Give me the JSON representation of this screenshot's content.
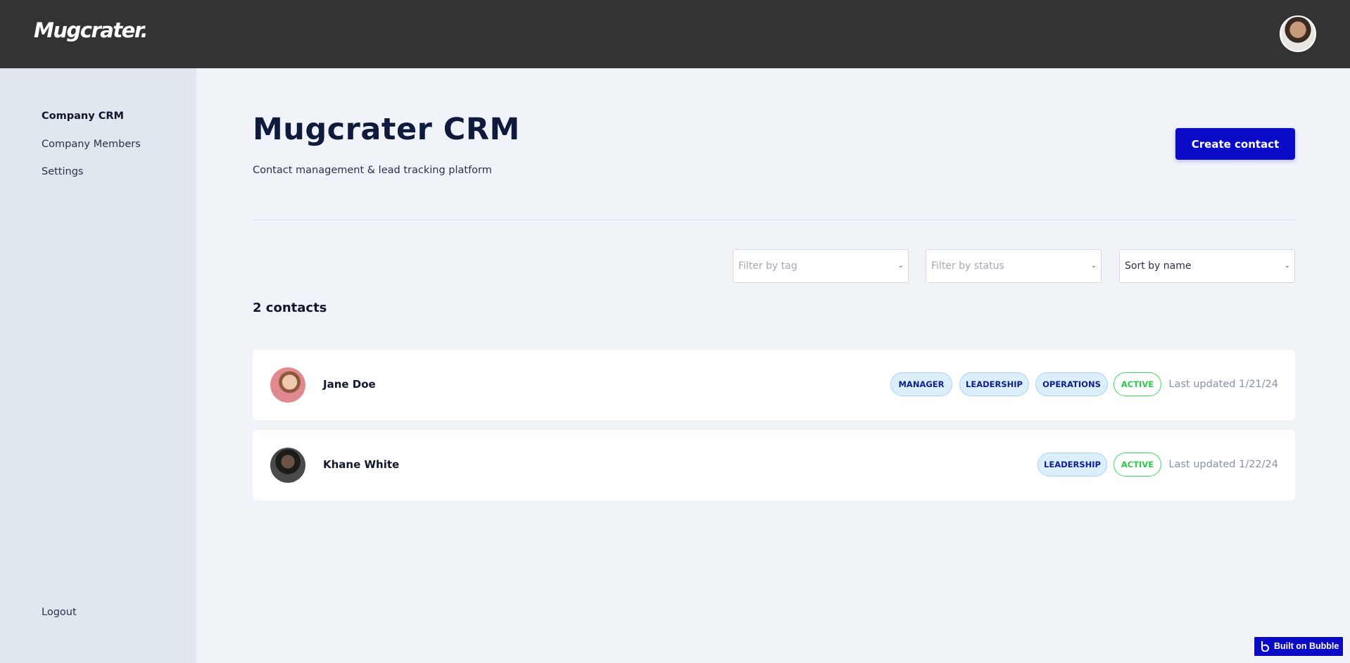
{
  "header": {
    "logo_text": "Mugcrater."
  },
  "sidebar": {
    "items": [
      {
        "label": "Company CRM",
        "active": true
      },
      {
        "label": "Company Members",
        "active": false
      },
      {
        "label": "Settings",
        "active": false
      }
    ],
    "logout_label": "Logout"
  },
  "main": {
    "title": "Mugcrater CRM",
    "subtitle": "Contact management & lead tracking platform",
    "create_button_label": "Create contact",
    "filters": {
      "tag_placeholder": "Filter by tag",
      "status_placeholder": "Filter by status",
      "sort_value": "Sort by name"
    },
    "contact_count_label": "2 contacts",
    "contacts": [
      {
        "name": "Jane Doe",
        "tags": [
          "MANAGER",
          "LEADERSHIP",
          "OPERATIONS"
        ],
        "status": "ACTIVE",
        "updated": "Last updated 1/21/24"
      },
      {
        "name": "Khane White",
        "tags": [
          "LEADERSHIP"
        ],
        "status": "ACTIVE",
        "updated": "Last updated 1/22/24"
      }
    ]
  },
  "badge": {
    "label": "Built on Bubble"
  },
  "colors": {
    "topbar": "#333333",
    "sidebar": "#e1e7ef",
    "background": "#f0f4f9",
    "accent": "#0b0bc7",
    "tag_blue_bg": "#dbeefc",
    "status_green": "#2cc84a"
  },
  "icons": {
    "select_chevron": "chevron-down-icon",
    "bubble_logo": "bubble-logo-icon"
  }
}
